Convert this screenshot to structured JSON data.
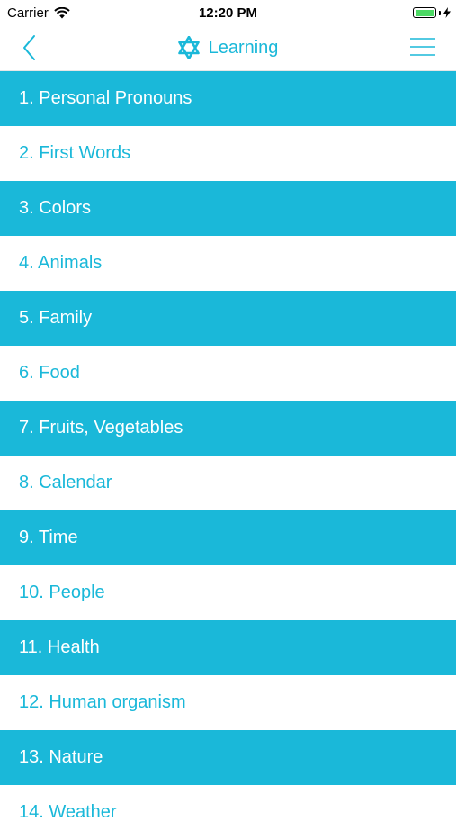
{
  "status": {
    "carrier": "Carrier",
    "time": "12:20 PM"
  },
  "nav": {
    "title": "Learning",
    "accent": "#1ab8d9"
  },
  "items": [
    "1. Personal Pronouns",
    "2. First Words",
    "3. Colors",
    "4. Animals",
    "5. Family",
    "6. Food",
    "7. Fruits, Vegetables",
    "8. Calendar",
    "9. Time",
    "10. People",
    "11. Health",
    "12. Human organism",
    "13. Nature",
    "14. Weather"
  ]
}
